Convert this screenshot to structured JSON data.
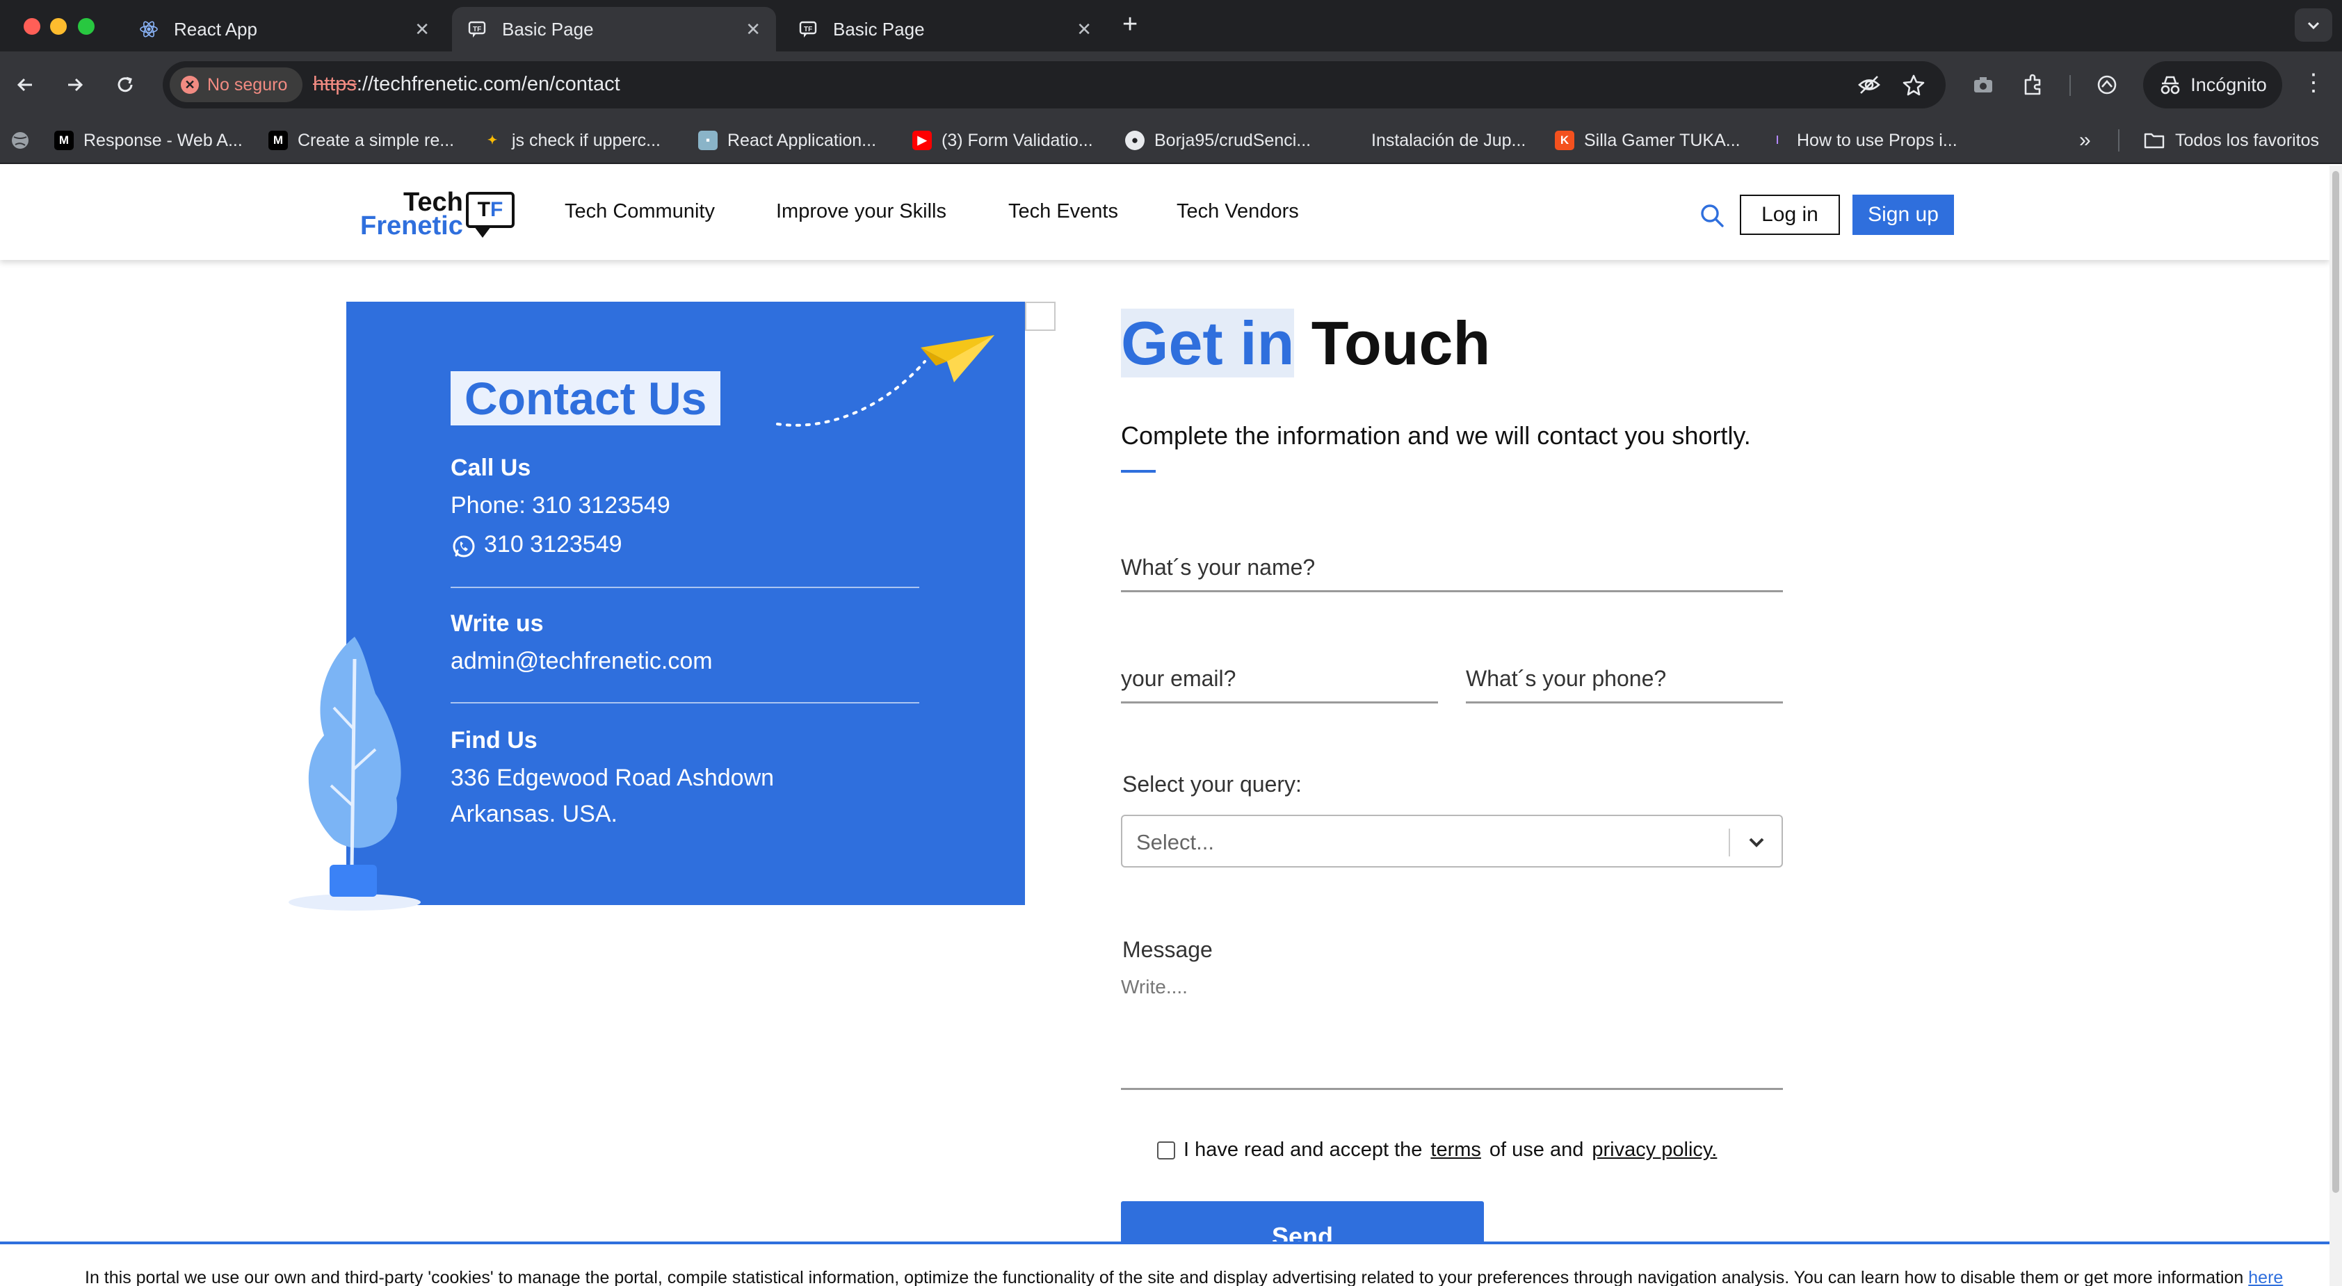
{
  "browser": {
    "tabs": [
      {
        "title": "React App",
        "active": false
      },
      {
        "title": "Basic Page",
        "active": true
      },
      {
        "title": "Basic Page",
        "active": false
      }
    ],
    "security_label": "No seguro",
    "url_scheme": "https",
    "url_rest": "://techfrenetic.com/en/contact",
    "profile_label": "Incógnito",
    "bookmarks": [
      {
        "label": "Response - Web A...",
        "icon": "m-icon"
      },
      {
        "label": "Create a simple re...",
        "icon": "medium-icon"
      },
      {
        "label": "js check if upperc...",
        "icon": "sparkle-icon"
      },
      {
        "label": "React Application...",
        "icon": "app-icon"
      },
      {
        "label": "(3) Form Validatio...",
        "icon": "youtube-icon"
      },
      {
        "label": "Borja95/crudSenci...",
        "icon": "github-icon"
      },
      {
        "label": "Instalación de Jup...",
        "icon": "blank-icon"
      },
      {
        "label": "Silla Gamer TUKA...",
        "icon": "k-icon"
      },
      {
        "label": "How to use Props i...",
        "icon": "purple-icon"
      }
    ],
    "all_bookmarks_label": "Todos los favoritos"
  },
  "header": {
    "logo_line1": "Tech",
    "logo_line2": "Frenetic",
    "logo_badge_a": "T",
    "logo_badge_b": "F",
    "nav": [
      "Tech Community",
      "Improve your Skills",
      "Tech Events",
      "Tech Vendors"
    ],
    "login_label": "Log in",
    "signup_label": "Sign up"
  },
  "contact_card": {
    "title": "Contact Us",
    "call_label": "Call Us",
    "phone_text": "Phone: 310 3123549",
    "whatsapp_text": "310 3123549",
    "write_label": "Write us",
    "email": "admin@techfrenetic.com",
    "find_label": "Find Us",
    "address_line1": "336 Edgewood Road Ashdown",
    "address_line2": "Arkansas. USA."
  },
  "form": {
    "title_highlight": "Get in",
    "title_rest": " Touch",
    "subtitle": "Complete the information and we will contact you shortly.",
    "name_placeholder": "What´s your name?",
    "email_placeholder": "your email?",
    "phone_placeholder": "What´s your phone?",
    "query_label": "Select your query:",
    "query_value": "Select...",
    "message_label": "Message",
    "message_placeholder": "Write....",
    "terms_prefix": "I have read and accept the",
    "terms_link": "terms",
    "terms_mid": "of use and",
    "privacy_link": "privacy policy.",
    "send_label": "Send"
  },
  "cookie_banner": {
    "text": "In this portal we use our own and third-party 'cookies' to manage the portal, compile statistical information, optimize the functionality of the site and display advertising related to your preferences through navigation analysis. You can learn how to disable them or get more information",
    "link": "here"
  },
  "colors": {
    "brand_blue": "#2f6fdd",
    "chrome_dark": "#202124",
    "chrome_toolbar": "#35363a"
  }
}
